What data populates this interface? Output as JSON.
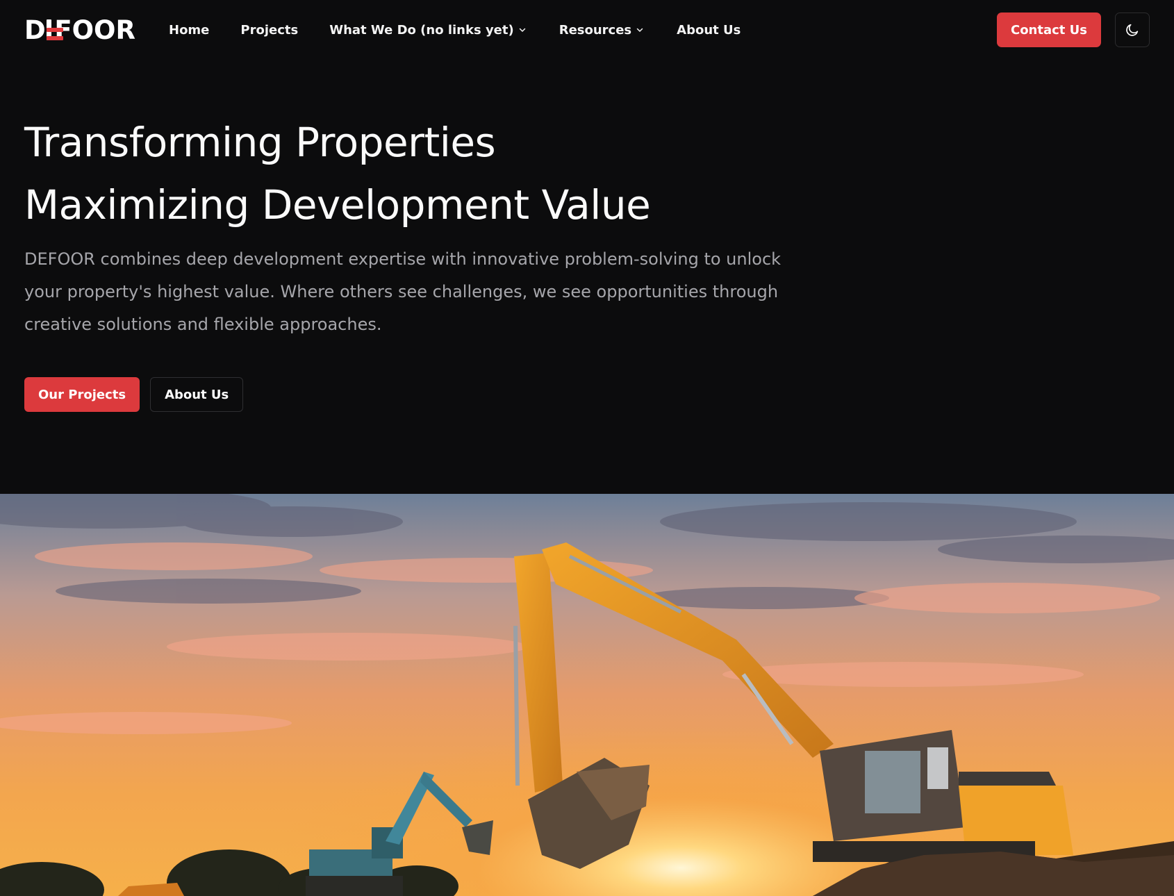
{
  "brand": {
    "name": "DEFOOR",
    "name_prefix": "D",
    "name_suffix": "FOOR"
  },
  "nav": {
    "links": [
      {
        "label": "Home",
        "has_dropdown": false
      },
      {
        "label": "Projects",
        "has_dropdown": false
      },
      {
        "label": "What We Do (no links yet)",
        "has_dropdown": true
      },
      {
        "label": "Resources",
        "has_dropdown": true
      },
      {
        "label": "About Us",
        "has_dropdown": false
      }
    ],
    "contact_label": "Contact Us",
    "theme_toggle_icon": "moon-icon"
  },
  "hero": {
    "title_line1": "Transforming Properties",
    "title_line2": "Maximizing Development Value",
    "description": "DEFOOR combines deep development expertise with innovative problem-solving to unlock your property's highest value. Where others see challenges, we see opportunities through creative solutions and flexible approaches.",
    "primary_cta": "Our Projects",
    "secondary_cta": "About Us",
    "image_subject": "excavators at sunset"
  },
  "colors": {
    "accent": "#dc3a3d",
    "background": "#0c0c0d",
    "text": "#ffffff",
    "muted_text": "#a6a6ab"
  }
}
